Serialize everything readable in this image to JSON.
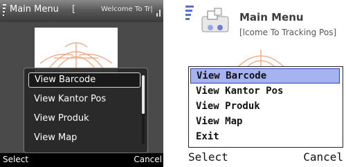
{
  "screens": [
    {
      "title": "Main Menu",
      "bracket": "[",
      "marquee": "Welcome To Tr|",
      "menu": [
        "View Barcode",
        "View Kantor Pos",
        "View Produk",
        "View Map"
      ],
      "selected_index": 0,
      "softkeys": {
        "left": "Select",
        "right": "Cancel"
      }
    },
    {
      "title": "Main Menu",
      "marquee": "[lcome To Tracking Pos]",
      "menu": [
        "View Barcode",
        "View Kantor Pos",
        "View Produk",
        "View Map",
        "Exit"
      ],
      "selected_index": 0,
      "softkeys": {
        "left": "Select",
        "right": "Cancel"
      }
    }
  ],
  "icons": {
    "left_phone": [
      "signal-icon",
      "battery-icon",
      "pos-logo-icon"
    ],
    "right_phone": [
      "signal-icon",
      "app-icon",
      "pos-logo-icon"
    ]
  },
  "colors": {
    "left_titlebar_dark": "#3a3a3a",
    "left_menu_bg": "#282828",
    "right_selection": "#a5b3f0",
    "logo_stroke": "#f2a27a"
  }
}
